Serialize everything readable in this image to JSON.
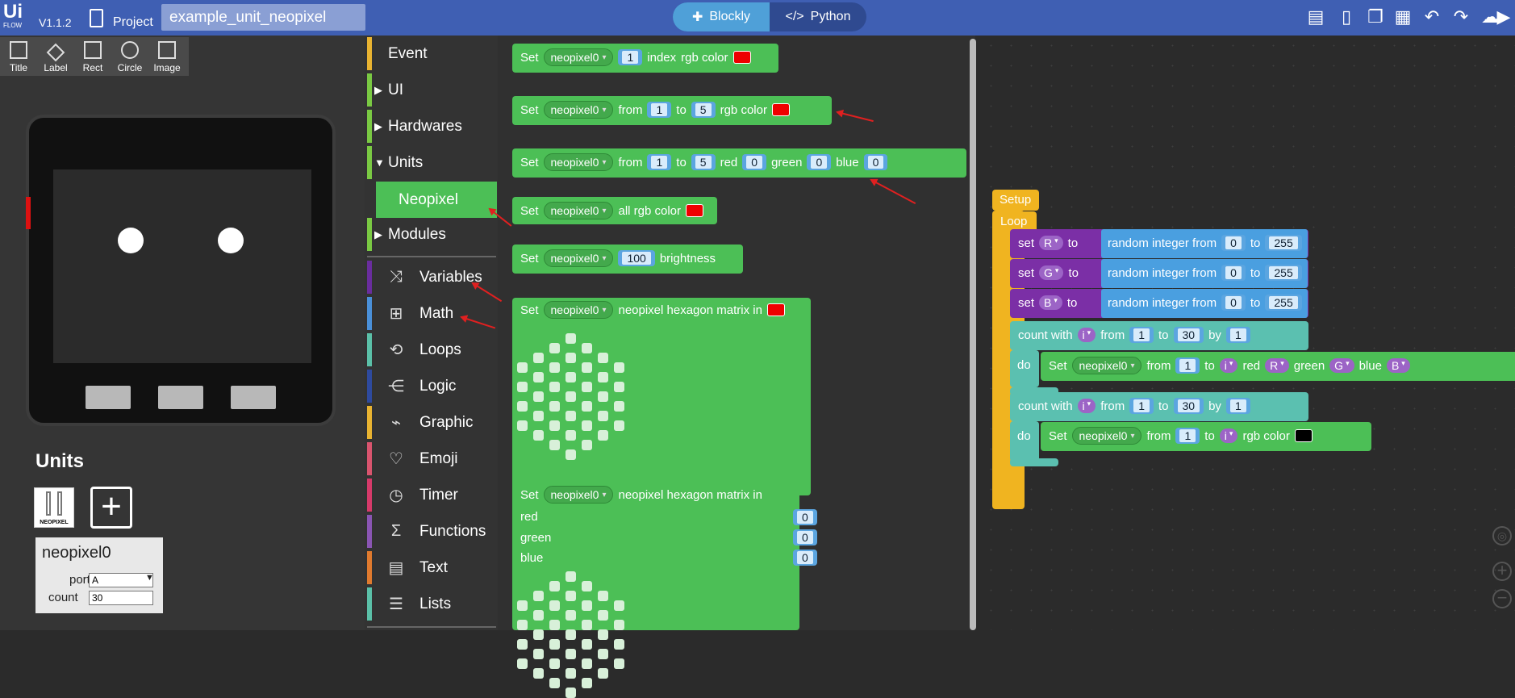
{
  "header": {
    "logo": "Ui",
    "logo_sub": "FLOW",
    "version": "V1.1.2",
    "project_label": "Project",
    "project_name": "example_unit_neopixel",
    "mode_blockly": "Blockly",
    "mode_python": "Python",
    "icons": [
      "chat-icon",
      "file-icon",
      "copy-icon",
      "layout-icon",
      "undo-icon",
      "redo-icon",
      "cloud-icon",
      "run-icon"
    ]
  },
  "tools": [
    {
      "label": "Title"
    },
    {
      "label": "Label"
    },
    {
      "label": "Rect"
    },
    {
      "label": "Circle"
    },
    {
      "label": "Image"
    }
  ],
  "units_panel": {
    "title": "Units",
    "thumb_label": "NEOPIXEL",
    "add_symbol": "+",
    "card": {
      "name": "neopixel0",
      "port_label": "port",
      "port_value": "A",
      "count_label": "count",
      "count_value": "30"
    }
  },
  "categories": [
    {
      "label": "Event",
      "color": "#e8b331"
    },
    {
      "label": "UI",
      "color": "#7ac943",
      "expand": "▶"
    },
    {
      "label": "Hardwares",
      "color": "#7ac943",
      "expand": "▶"
    },
    {
      "label": "Units",
      "color": "#7ac943",
      "expand": "▼"
    },
    {
      "label": "Neopixel",
      "color": "#4cbf56"
    },
    {
      "label": "Modules",
      "color": "#7ac943",
      "expand": "▶"
    },
    {
      "label": "Variables",
      "color": "#6a2d9e"
    },
    {
      "label": "Math",
      "color": "#4a90d9"
    },
    {
      "label": "Loops",
      "color": "#5bc0a8"
    },
    {
      "label": "Logic",
      "color": "#2e4a9e"
    },
    {
      "label": "Graphic",
      "color": "#e8b331"
    },
    {
      "label": "Emoji",
      "color": "#d9546e"
    },
    {
      "label": "Timer",
      "color": "#d63a6a"
    },
    {
      "label": "Functions",
      "color": "#8a55b3"
    },
    {
      "label": "Text",
      "color": "#e07a2e"
    },
    {
      "label": "Lists",
      "color": "#5bc0a8"
    }
  ],
  "flyout": {
    "set": "Set",
    "neopixel": "neopixel0",
    "index": "index",
    "rgb_color": "rgb color",
    "from": "from",
    "to": "to",
    "red": "red",
    "green": "green",
    "blue": "blue",
    "all_rgb_color": "all rgb color",
    "brightness": "brightness",
    "hexagon": "neopixel hexagon matrix in",
    "v1": "1",
    "v5": "5",
    "v0": "0",
    "v100": "100"
  },
  "workspace": {
    "setup": "Setup",
    "loop": "Loop",
    "set_lower": "set",
    "to": "to",
    "var_r": "R",
    "var_g": "G",
    "var_b": "B",
    "random": "random integer from",
    "min": "0",
    "max": "255",
    "count_with": "count with",
    "var_i": "i",
    "from": "from",
    "by": "by",
    "do": "do",
    "start": "1",
    "end": "30",
    "step": "1",
    "set": "Set",
    "neopixel": "neopixel0",
    "red": "red",
    "green": "green",
    "blue": "blue",
    "rgb_color": "rgb color"
  }
}
